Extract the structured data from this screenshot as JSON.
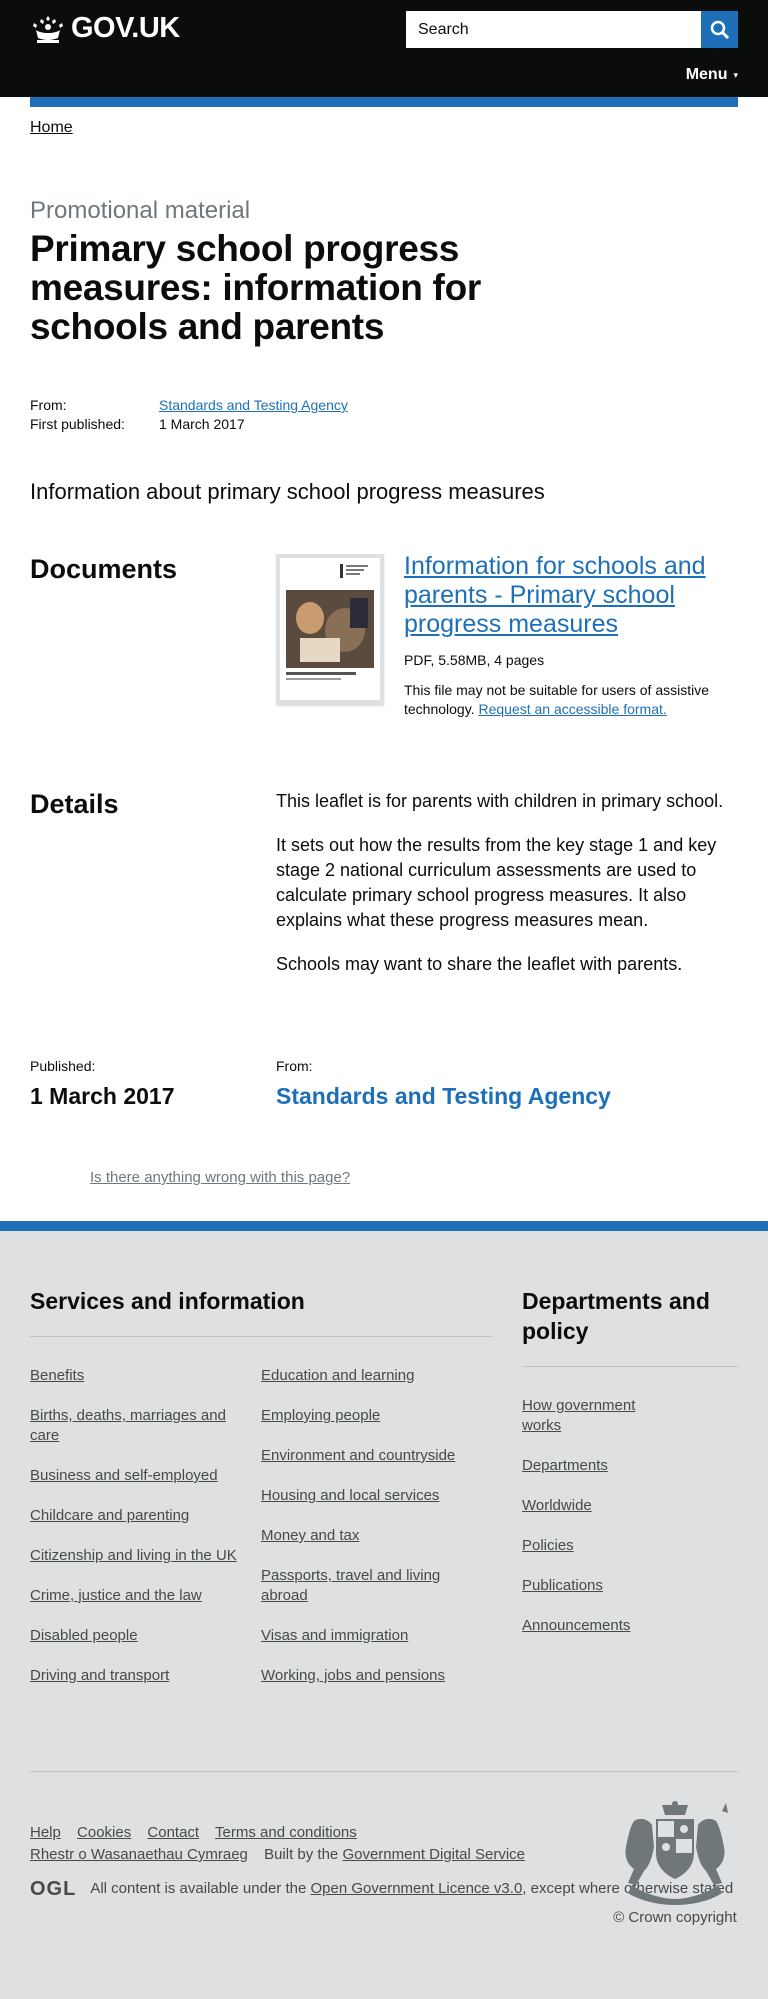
{
  "header": {
    "logo_text": "GOV.UK",
    "search_placeholder": "Search",
    "menu_label": "Menu",
    "menu_caret": "▾"
  },
  "breadcrumb": {
    "home": "Home"
  },
  "page": {
    "caption": "Promotional material",
    "title": "Primary school progress measures: information for schools and parents"
  },
  "meta": {
    "from_label": "From:",
    "from_value": "Standards and Testing Agency",
    "published_label": "First published:",
    "published_value": "1 March 2017"
  },
  "summary": "Information about primary school progress measures",
  "documents": {
    "heading": "Documents",
    "title": "Information for schools and parents - Primary school progress measures",
    "file_meta": "PDF, 5.58MB, 4 pages",
    "note": "This file may not be suitable for users of assistive technology.",
    "request_link": "Request an accessible format."
  },
  "details": {
    "heading": "Details",
    "paragraphs": [
      "This leaflet is for parents with children in primary school.",
      "It sets out how the results from the key stage 1 and key stage 2 national curriculum assessments are used to calculate primary school progress measures. It also explains what these progress measures mean.",
      "Schools may want to share the leaflet with parents."
    ]
  },
  "published": {
    "published_label": "Published:",
    "published_value": "1 March 2017",
    "from_label": "From:",
    "from_value": "Standards and Testing Agency"
  },
  "report_link": "Is there anything wrong with this page?",
  "footer": {
    "services_heading": "Services and information",
    "services_col1": [
      "Benefits",
      "Births, deaths, marriages and care",
      "Business and self-employed",
      "Childcare and parenting",
      "Citizenship and living in the UK",
      "Crime, justice and the law",
      "Disabled people",
      "Driving and transport"
    ],
    "services_col2": [
      "Education and learning",
      "Employing people",
      "Environment and countryside",
      "Housing and local services",
      "Money and tax",
      "Passports, travel and living abroad",
      "Visas and immigration",
      "Working, jobs and pensions"
    ],
    "depts_heading": "Departments and policy",
    "depts_links": [
      "How government works",
      "Departments",
      "Worldwide",
      "Policies",
      "Publications",
      "Announcements"
    ],
    "meta_links": [
      "Help",
      "Cookies",
      "Contact",
      "Terms and conditions"
    ],
    "welsh_link": "Rhestr o Wasanaethau Cymraeg",
    "built_by": "Built by the",
    "gds_link": "Government Digital Service",
    "ogl": "OGL",
    "licence_prefix": "All content is available under the",
    "licence_link": "Open Government Licence v3.0",
    "licence_suffix": ", except where otherwise stated",
    "copyright": "© Crown copyright"
  },
  "colors": {
    "brand_blue": "#1d70b8",
    "header_black": "#0b0c0c",
    "footer_grey": "#dee0e2"
  },
  "icons": {
    "logo": "crown-icon",
    "search": "search-icon",
    "crest": "royal-coat-of-arms-icon"
  }
}
